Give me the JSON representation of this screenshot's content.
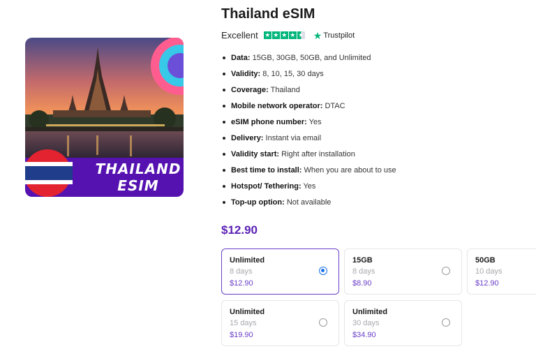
{
  "product": {
    "title": "Thailand eSIM",
    "rating_label": "Excellent",
    "trustpilot_label": "Trustpilot",
    "image_text_line1": "THAILAND",
    "image_text_line2": "ESIM",
    "price": "$12.90"
  },
  "features": [
    {
      "key": "Data:",
      "value": " 15GB, 30GB, 50GB, and Unlimited"
    },
    {
      "key": "Validity:",
      "value": " 8, 10, 15, 30 days"
    },
    {
      "key": "Coverage:",
      "value": " Thailand"
    },
    {
      "key": "Mobile network operator:",
      "value": " DTAC"
    },
    {
      "key": "eSIM phone number:",
      "value": " Yes"
    },
    {
      "key": "Delivery:",
      "value": " Instant via email"
    },
    {
      "key": "Validity start:",
      "value": " Right after installation"
    },
    {
      "key": "Best time to install:",
      "value": " When you are about to use"
    },
    {
      "key": "Hotspot/ Tethering:",
      "value": " Yes"
    },
    {
      "key": "Top-up option:",
      "value": " Not available"
    }
  ],
  "plans": [
    {
      "name": "Unlimited",
      "days": "8 days",
      "price": "$12.90",
      "selected": true
    },
    {
      "name": "15GB",
      "days": "8 days",
      "price": "$8.90",
      "selected": false
    },
    {
      "name": "50GB",
      "days": "10 days",
      "price": "$12.90",
      "selected": false
    },
    {
      "name": "Unlimited",
      "days": "15 days",
      "price": "$19.90",
      "selected": false
    },
    {
      "name": "Unlimited",
      "days": "30 days",
      "price": "$34.90",
      "selected": false
    }
  ],
  "colors": {
    "accent": "#6a3fc6",
    "price": "#5b21b6",
    "trustpilot_green": "#00b67a",
    "radio_selected": "#1a73e8",
    "promo_banner": "#5512b0"
  }
}
